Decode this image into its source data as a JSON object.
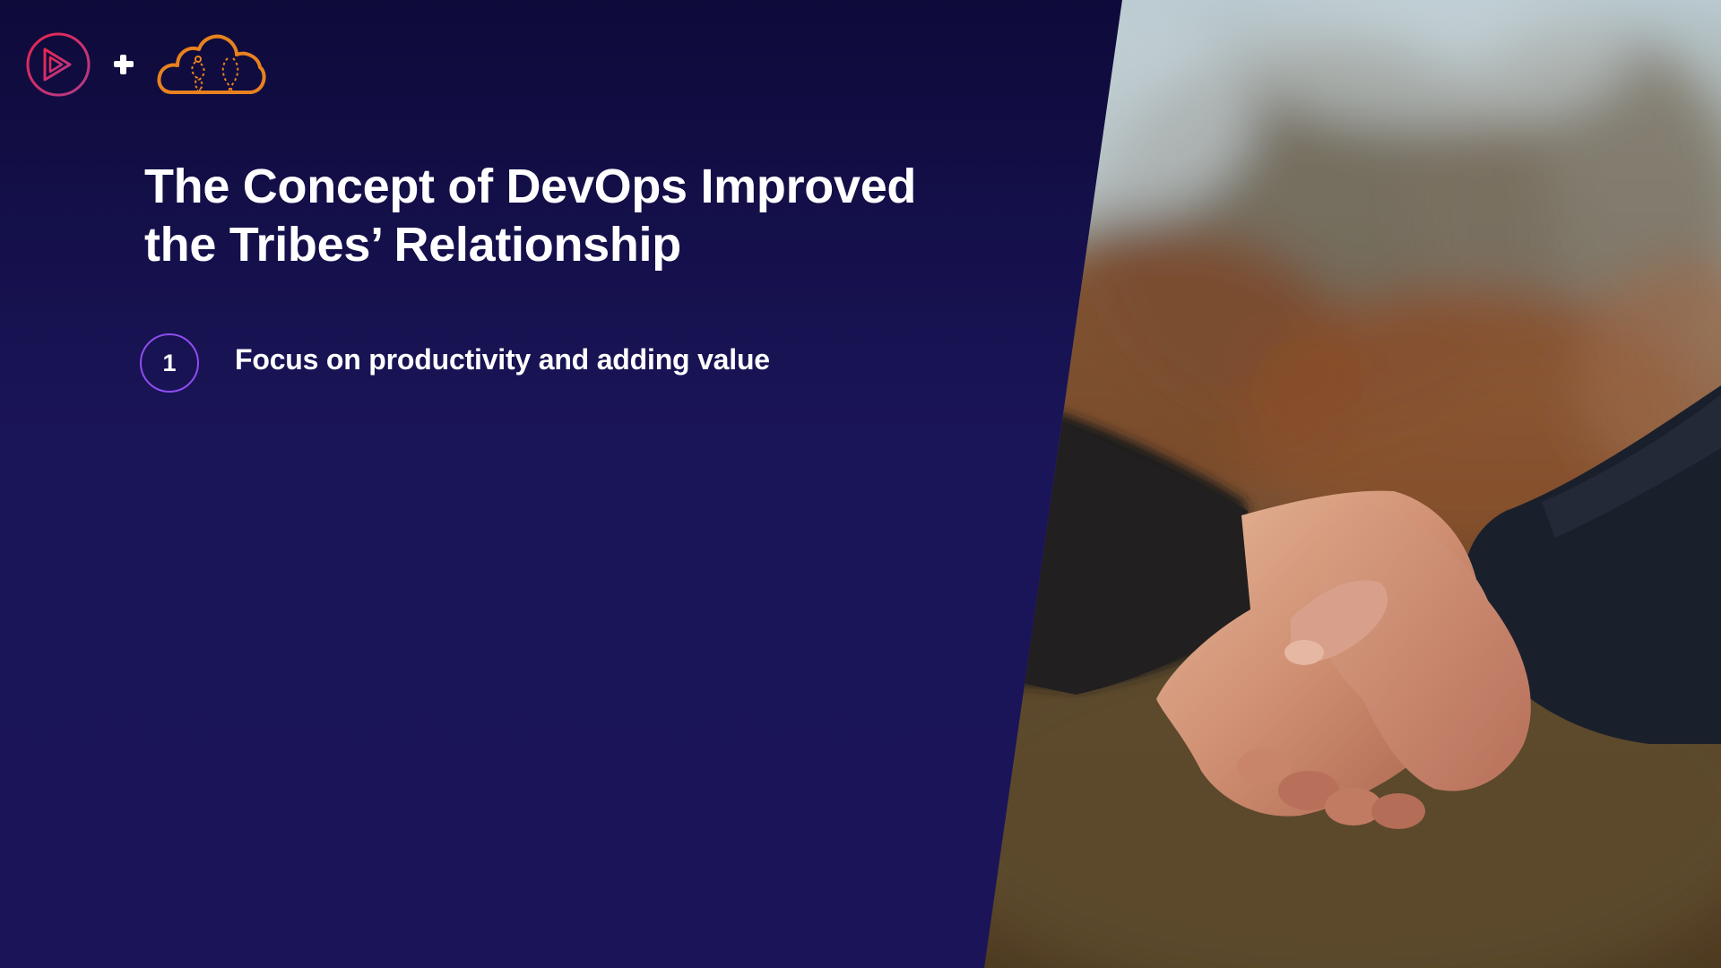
{
  "slide": {
    "title_line_1": "The Concept of DevOps Improved",
    "title_line_2": "the Tribes’ Relationship",
    "items": [
      {
        "number": "1",
        "text": "Focus on productivity and adding value"
      }
    ]
  },
  "logos": {
    "left_logo_icon": "play-button-icon",
    "plus_icon": "plus-icon",
    "right_logo_icon": "cloud-icon"
  },
  "photo": {
    "subject": "handshake-photo"
  },
  "colors": {
    "background_top": "#0e0a3a",
    "background_bottom": "#1b1458",
    "number_circle_border": "#8e4df0",
    "play_logo_gradient_start": "#e8264f",
    "play_logo_gradient_end": "#b23a8a",
    "cloud_logo": "#e8821f"
  }
}
